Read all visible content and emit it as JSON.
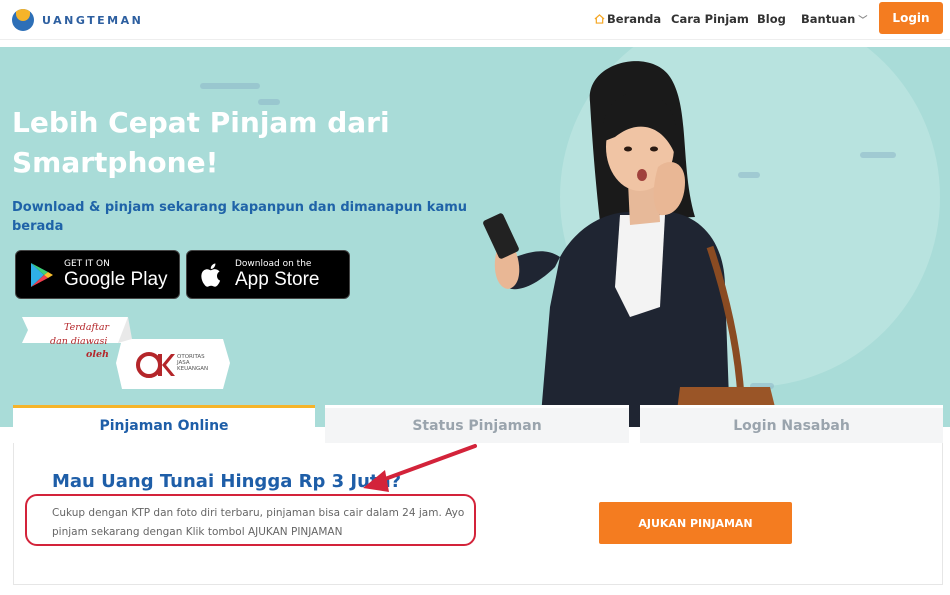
{
  "brand": {
    "name": "UANGTEMAN"
  },
  "nav": {
    "items": [
      {
        "label": "Beranda",
        "icon": "home-icon"
      },
      {
        "label": "Cara Pinjam"
      },
      {
        "label": "Blog"
      },
      {
        "label": "Bantuan",
        "icon": "chevron-down-icon"
      }
    ],
    "login_label": "Login"
  },
  "hero": {
    "title": "Lebih Cepat Pinjam dari Smartphone!",
    "subtitle": "Download & pinjam sekarang kapanpun dan dimanapun kamu berada",
    "google_play": {
      "small": "GET IT ON",
      "big": "Google Play"
    },
    "app_store": {
      "small": "Download on the",
      "big": "App Store"
    },
    "ojk": {
      "line1": "Terdaftar",
      "line2": "dan diawasi",
      "line3": "oleh",
      "logo": "OJK",
      "small1": "OTORITAS",
      "small2": "JASA",
      "small3": "KEUANGAN"
    }
  },
  "tabs": [
    {
      "label": "Pinjaman Online",
      "active": true
    },
    {
      "label": "Status Pinjaman",
      "active": false
    },
    {
      "label": "Login Nasabah",
      "active": false
    }
  ],
  "panel": {
    "title": "Mau Uang Tunai Hingga Rp 3 Juta?",
    "description": "Cukup dengan KTP dan foto diri terbaru, pinjaman bisa cair dalam 24 jam. Ayo pinjam sekarang dengan Klik tombol AJUKAN PINJAMAN",
    "apply_label": "AJUKAN PINJAMAN"
  },
  "colors": {
    "accent": "#f47c20",
    "brand_blue": "#1e5ea8",
    "hero_bg": "#a9dcd8",
    "annotation_red": "#d3233a"
  }
}
